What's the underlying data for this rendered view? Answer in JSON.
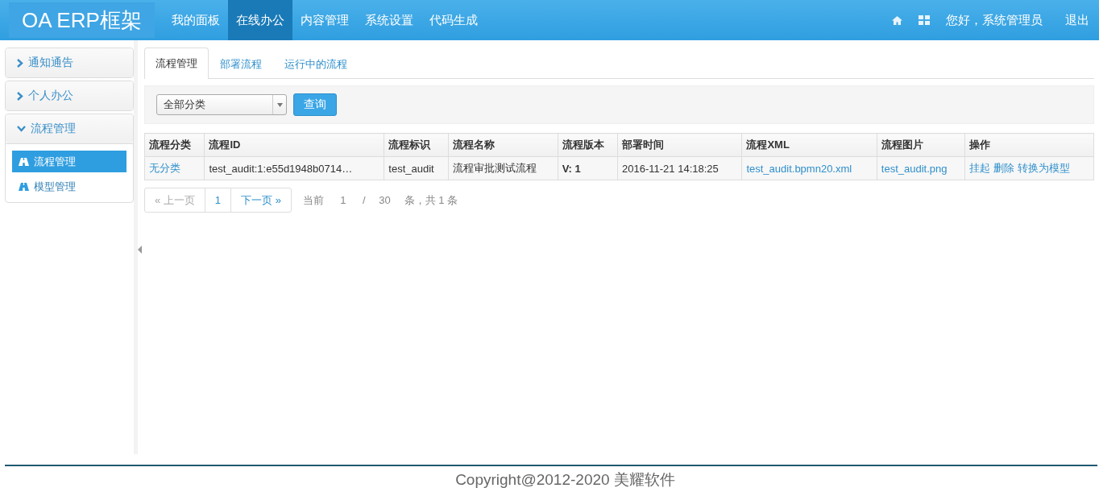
{
  "header": {
    "logo": "OA ERP框架",
    "nav": [
      {
        "label": "我的面板",
        "selected": false
      },
      {
        "label": "在线办公",
        "selected": true
      },
      {
        "label": "内容管理",
        "selected": false
      },
      {
        "label": "系统设置",
        "selected": false
      },
      {
        "label": "代码生成",
        "selected": false
      }
    ],
    "greeting": "您好，系统管理员",
    "logout": "退出"
  },
  "sidebar": {
    "groups": [
      {
        "label": "通知通告",
        "expanded": false
      },
      {
        "label": "个人办公",
        "expanded": false
      },
      {
        "label": "流程管理",
        "expanded": true,
        "children": [
          {
            "label": "流程管理",
            "selected": true
          },
          {
            "label": "模型管理",
            "selected": false
          }
        ]
      }
    ]
  },
  "tabs": [
    {
      "label": "流程管理",
      "selected": true
    },
    {
      "label": "部署流程",
      "selected": false
    },
    {
      "label": "运行中的流程",
      "selected": false
    }
  ],
  "filter": {
    "category": "全部分类",
    "button": "查询"
  },
  "table": {
    "columns": [
      "流程分类",
      "流程ID",
      "流程标识",
      "流程名称",
      "流程版本",
      "部署时间",
      "流程XML",
      "流程图片",
      "操作"
    ],
    "rows": [
      {
        "cells": [
          {
            "text": "无分类",
            "kind": "link"
          },
          {
            "text": "test_audit:1:e55d1948b0714…",
            "kind": "text"
          },
          {
            "text": "test_audit",
            "kind": "text"
          },
          {
            "text": "流程审批测试流程",
            "kind": "text"
          },
          {
            "text": "V: 1",
            "kind": "bold"
          },
          {
            "text": "2016-11-21 14:18:25",
            "kind": "text"
          },
          {
            "text": "test_audit.bpmn20.xml",
            "kind": "link"
          },
          {
            "text": "test_audit.png",
            "kind": "link"
          }
        ],
        "actions": [
          "挂起",
          "删除",
          "转换为模型"
        ]
      }
    ]
  },
  "pagination": {
    "prev": {
      "label": "« 上一页",
      "disabled": true
    },
    "pages": [
      {
        "label": "1",
        "selected": true
      }
    ],
    "next": {
      "label": "下一页 »",
      "disabled": false
    },
    "current_label": "当前",
    "page_value": "1",
    "separator": "/",
    "size_value": "30",
    "summary": "条，共 1 条"
  },
  "footer": {
    "copyright": "Copyright@2012-2020 美耀软件"
  }
}
